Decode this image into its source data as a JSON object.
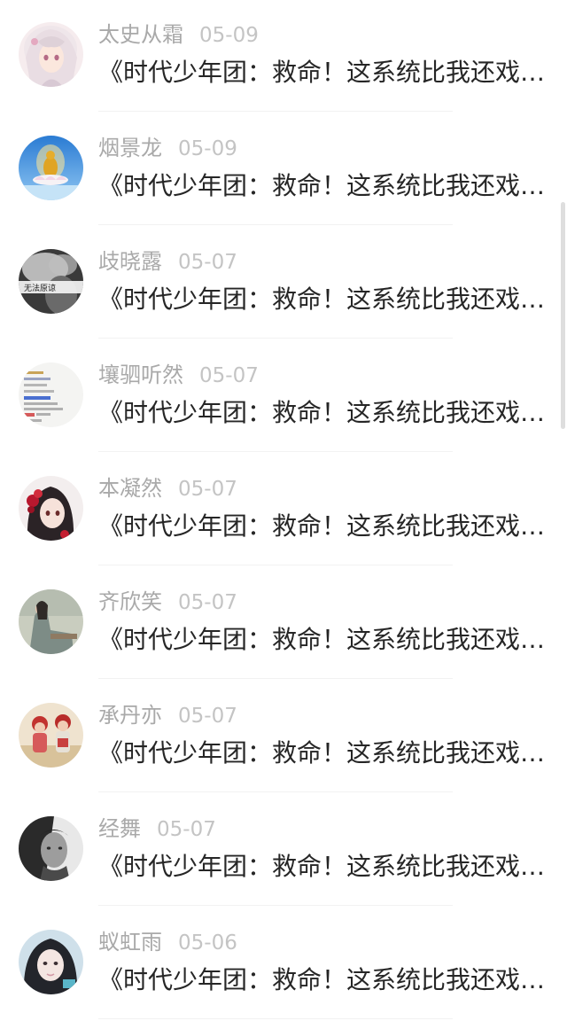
{
  "comments": [
    {
      "name": "太史从霜",
      "date": "05-09",
      "title": "《时代少年团：救命！这系统比我还戏精》",
      "avatar_icon": "anime-girl-white-hair-avatar"
    },
    {
      "name": "烟景龙",
      "date": "05-09",
      "title": "《时代少年团：救命！这系统比我还戏精》",
      "avatar_icon": "golden-buddha-on-lotus-avatar"
    },
    {
      "name": "歧晓露",
      "date": "05-07",
      "title": "《时代少年团：救命！这系统比我还戏精》",
      "avatar_icon": "smoke-portrait-avatar",
      "avatar_text": "无法原谅"
    },
    {
      "name": "壤驷听然",
      "date": "05-07",
      "title": "《时代少年团：救命！这系统比我还戏精》",
      "avatar_icon": "text-note-avatar"
    },
    {
      "name": "本凝然",
      "date": "05-07",
      "title": "《时代少年团：救命！这系统比我还戏精》",
      "avatar_icon": "anime-girl-red-flower-avatar"
    },
    {
      "name": "齐欣笑",
      "date": "05-07",
      "title": "《时代少年团：救命！这系统比我还戏精》",
      "avatar_icon": "sitting-woman-avatar"
    },
    {
      "name": "承丹亦",
      "date": "05-07",
      "title": "《时代少年团：救命！这系统比我还戏精》",
      "avatar_icon": "two-children-avatar"
    },
    {
      "name": "经舞",
      "date": "05-07",
      "title": "《时代少年团：救命！这系统比我还戏精》",
      "avatar_icon": "man-portrait-bw-avatar"
    },
    {
      "name": "蚁虹雨",
      "date": "05-06",
      "title": "《时代少年团：救命！这系统比我还戏精》",
      "avatar_icon": "girl-selfie-avatar"
    }
  ]
}
